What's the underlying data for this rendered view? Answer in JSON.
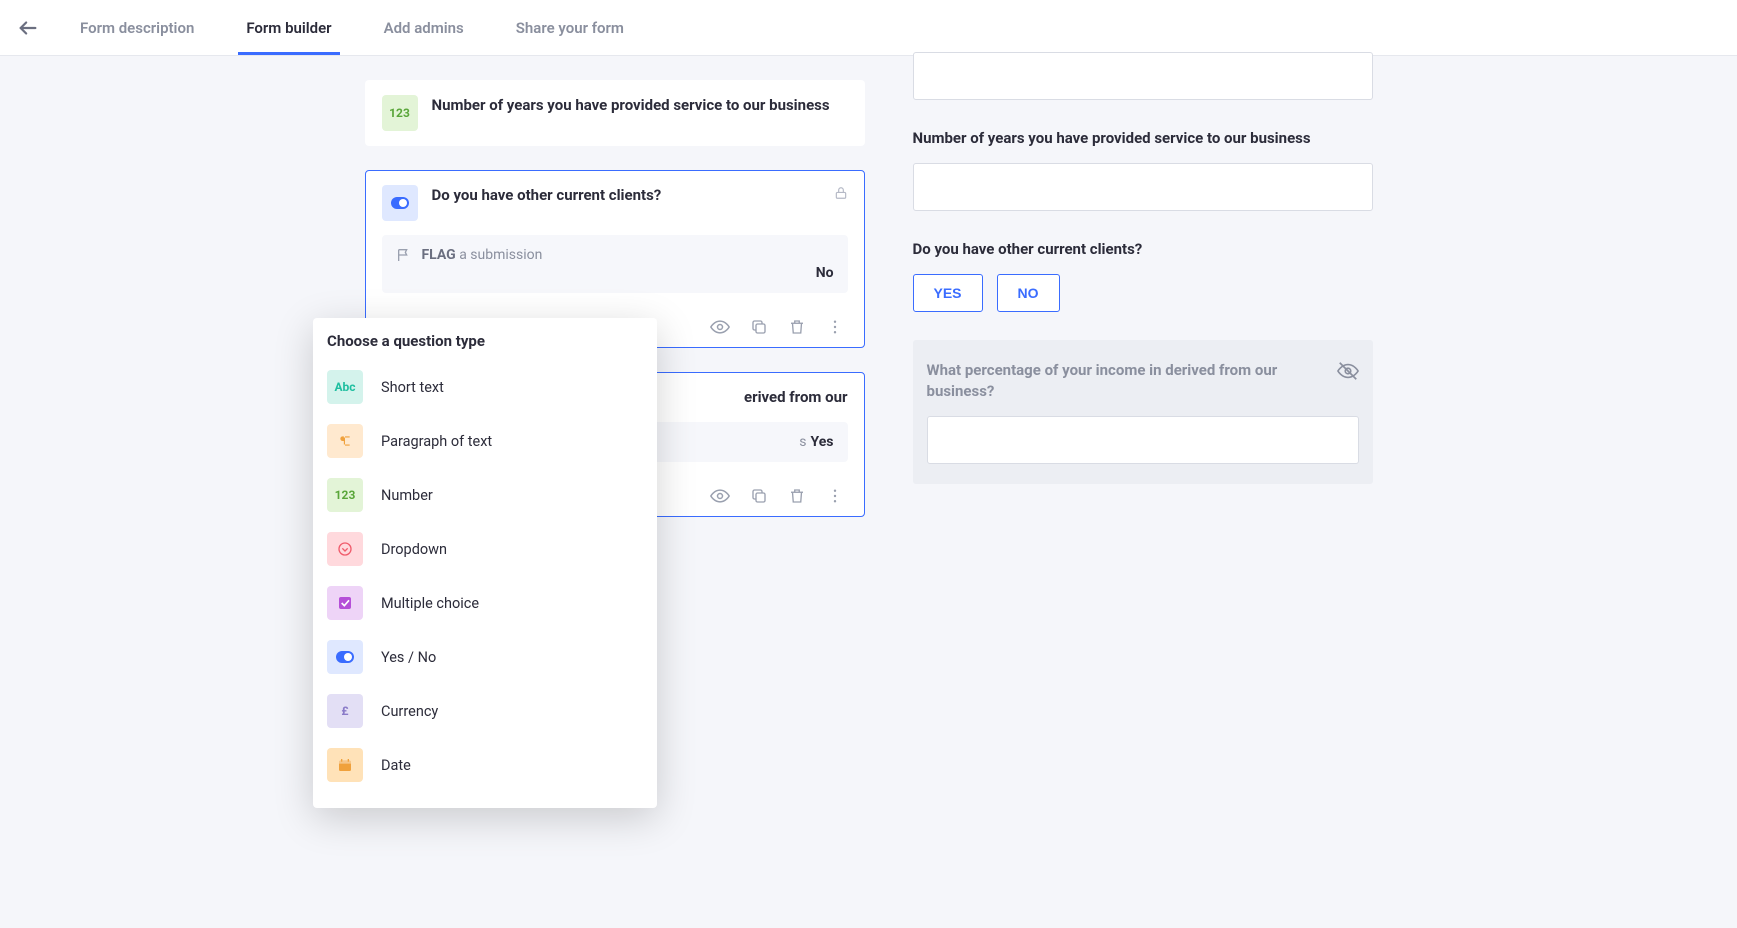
{
  "tabs": {
    "description": "Form description",
    "builder": "Form builder",
    "admins": "Add admins",
    "share": "Share your form"
  },
  "builder": {
    "q_years": "Number of years you have provided service to our business",
    "q_clients": "Do you have other current clients?",
    "q_percent_partial": "erived from our",
    "flag_label": "FLAG",
    "flag_rest": " a submission",
    "flag_ans_no": "No",
    "flag_ans_yes": "Yes",
    "flag_yes_prefix_visible": "s"
  },
  "popup": {
    "title": "Choose a question type",
    "types": {
      "short": "Short text",
      "para": "Paragraph of text",
      "num": "Number",
      "drop": "Dropdown",
      "multi": "Multiple choice",
      "yesno": "Yes / No",
      "curr": "Currency",
      "date": "Date"
    }
  },
  "preview": {
    "q_years": "Number of years you have provided service to our business",
    "q_clients": "Do you have other current clients?",
    "yes": "YES",
    "no": "NO",
    "q_percent": "What percentage of your income in derived from our business?"
  },
  "icons": {
    "num_chip": "123",
    "abc_chip": "Abc",
    "curr_chip": "£"
  }
}
